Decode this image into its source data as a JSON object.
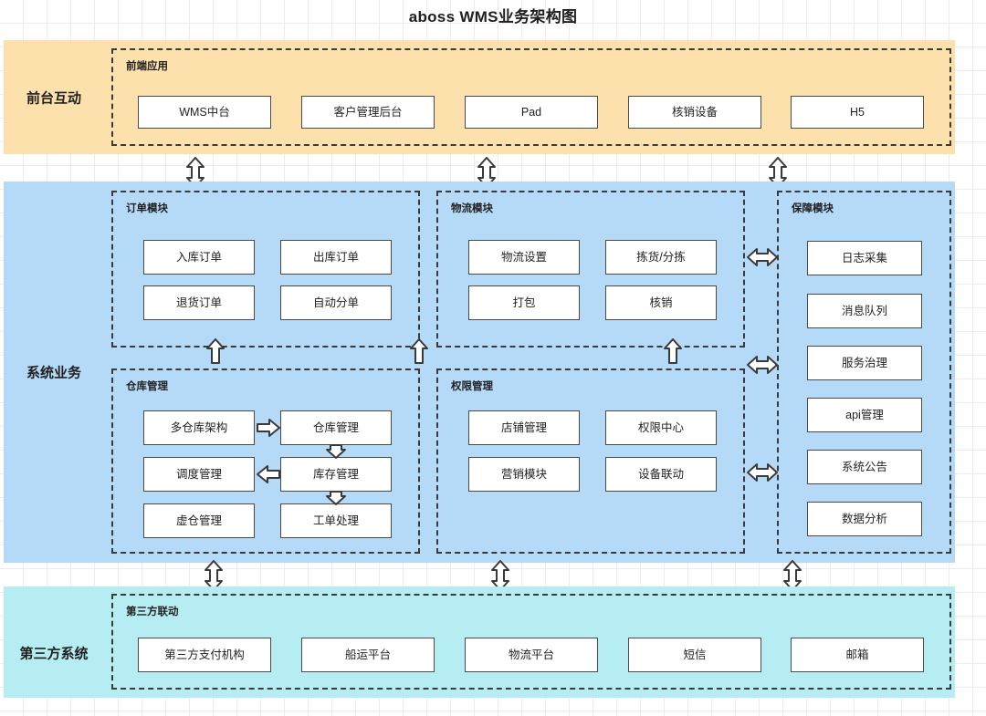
{
  "title": "aboss WMS业务架构图",
  "colors": {
    "band_front": "#FCE1AD",
    "band_system": "#B5DAF8",
    "band_third": "#B5EDF2",
    "node_border": "#4a4a4a",
    "group_border": "#3a3a3a",
    "arrow_fill": "#ffffff",
    "arrow_stroke": "#3a3a3a",
    "grid_line": "#ececec",
    "text": "#1f1f1f"
  },
  "bands": [
    {
      "id": "front",
      "label": "前台互动"
    },
    {
      "id": "system",
      "label": "系统业务"
    },
    {
      "id": "third",
      "label": "第三方系统"
    }
  ],
  "groups": {
    "frontend_apps": {
      "title": "前端应用",
      "nodes": [
        {
          "label": "WMS中台"
        },
        {
          "label": "客户管理后台"
        },
        {
          "label": "Pad"
        },
        {
          "label": "核销设备"
        },
        {
          "label": "H5"
        }
      ]
    },
    "order_module": {
      "title": "订单模块",
      "nodes": [
        {
          "label": "入库订单"
        },
        {
          "label": "出库订单"
        },
        {
          "label": "退货订单"
        },
        {
          "label": "自动分单"
        }
      ]
    },
    "logistics_module": {
      "title": "物流模块",
      "nodes": [
        {
          "label": "物流设置"
        },
        {
          "label": "拣货/分拣"
        },
        {
          "label": "打包"
        },
        {
          "label": "核销"
        }
      ]
    },
    "warehouse_module": {
      "title": "仓库管理",
      "nodes": [
        {
          "label": "多仓库架构"
        },
        {
          "label": "仓库管理"
        },
        {
          "label": "调度管理"
        },
        {
          "label": "库存管理"
        },
        {
          "label": "虚仓管理"
        },
        {
          "label": "工单处理"
        }
      ]
    },
    "permission_module": {
      "title": "权限管理",
      "nodes": [
        {
          "label": "店铺管理"
        },
        {
          "label": "权限中心"
        },
        {
          "label": "营销模块"
        },
        {
          "label": "设备联动"
        }
      ]
    },
    "guarantee_module": {
      "title": "保障模块",
      "nodes": [
        {
          "label": "日志采集"
        },
        {
          "label": "消息队列"
        },
        {
          "label": "服务治理"
        },
        {
          "label": "api管理"
        },
        {
          "label": "系统公告"
        },
        {
          "label": "数据分析"
        }
      ]
    },
    "third_party": {
      "title": "第三方联动",
      "nodes": [
        {
          "label": "第三方支付机构"
        },
        {
          "label": "船运平台"
        },
        {
          "label": "物流平台"
        },
        {
          "label": "短信"
        },
        {
          "label": "邮箱"
        }
      ]
    }
  },
  "connectors": {
    "front_to_system": [
      {
        "name": "front-system-left"
      },
      {
        "name": "front-system-center"
      },
      {
        "name": "front-system-right"
      }
    ],
    "system_internal_up": [
      {
        "name": "warehouse-to-order-left"
      },
      {
        "name": "warehouse-to-order-right"
      },
      {
        "name": "permission-to-logistics"
      }
    ],
    "to_guarantee": [
      {
        "name": "logistics-to-guarantee"
      },
      {
        "name": "modules-to-guarantee-mid"
      },
      {
        "name": "permission-to-guarantee"
      }
    ],
    "system_to_third": [
      {
        "name": "system-third-left"
      },
      {
        "name": "system-third-center"
      },
      {
        "name": "system-third-right"
      }
    ],
    "warehouse_flow": [
      {
        "name": "multi-warehouse-to-warehouse"
      },
      {
        "name": "warehouse-to-inventory"
      },
      {
        "name": "inventory-to-dispatch"
      },
      {
        "name": "inventory-to-workorder"
      }
    ]
  }
}
